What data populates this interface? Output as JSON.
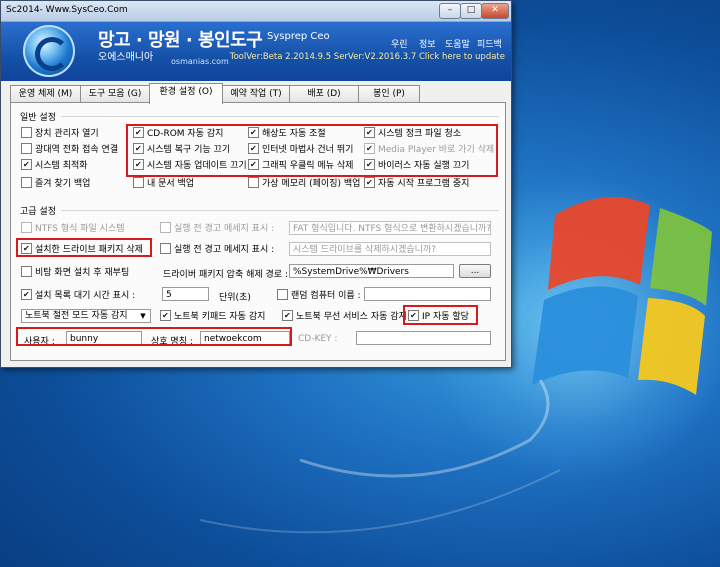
{
  "window": {
    "title": "Sc2014- Www.SysCeo.Com",
    "controls": {
      "minimize": "–",
      "maximize": "□",
      "close": "✕"
    }
  },
  "banner": {
    "title": "망고 · 망원 · 봉인도구",
    "sysprep": "Sysprep Ceo",
    "subtitle": "오에스매니아",
    "site": "osmanias.com",
    "menu": [
      "우린",
      "정보",
      "도움말",
      "피드백"
    ],
    "version": "ToolVer:Beta 2.2014.9.5 SerVer:V2.2016.3.7 Click here to update"
  },
  "tabs": [
    {
      "label": "운영 체제 (M)"
    },
    {
      "label": "도구 모음 (G)"
    },
    {
      "label": "환경 설정 (O)",
      "active": true
    },
    {
      "label": "예약 작업 (T)"
    },
    {
      "label": "배포 (D)"
    },
    {
      "label": "봉인 (P)"
    }
  ],
  "general": {
    "title": "일반 설정",
    "col1": [
      {
        "label": "장치 관리자 열기",
        "checked": false
      },
      {
        "label": "광대역 전화 접속 연결",
        "checked": false
      },
      {
        "label": "시스템 최적화",
        "checked": true
      },
      {
        "label": "즐겨 찾기 백업",
        "checked": false
      }
    ],
    "col2": [
      {
        "label": "CD-ROM 자동 감지",
        "checked": true
      },
      {
        "label": "시스템 복구 기능 끄기",
        "checked": true
      },
      {
        "label": "시스템 자동 업데이트 끄기",
        "checked": true
      },
      {
        "label": "내 문서 백업",
        "checked": false
      }
    ],
    "col3": [
      {
        "label": "해상도 자동 조절",
        "checked": true
      },
      {
        "label": "인터넷 마법사 건너 뛰기",
        "checked": true
      },
      {
        "label": "그래픽 우클릭 메뉴 삭제",
        "checked": true
      },
      {
        "label": "가상 메모리 (페이징) 백업",
        "checked": false
      }
    ],
    "col4": [
      {
        "label": "시스템 정크 파일 청소",
        "checked": true
      },
      {
        "label": "Media Player 바로 가기 삭제",
        "checked": true,
        "disabled": true
      },
      {
        "label": "바이러스 자동 실행 끄기",
        "checked": true
      },
      {
        "label": "자동 시작 프로그램 중지",
        "checked": true
      }
    ]
  },
  "advanced": {
    "title": "고급 설정",
    "ntfs": {
      "label": "NTFS 형식 파일 시스템",
      "checked": false
    },
    "warn1": {
      "label": "실행 전 경고 메세지 표시 :",
      "checked": false,
      "value": "FAT 형식입니다. NTFS 형식으로 변환하시겠습니까?"
    },
    "driver_delete": {
      "label": "설치한 드라이브 패키지 삭제",
      "checked": true
    },
    "warn2": {
      "label": "실행 전 경고 메세지 표시 :",
      "checked": false,
      "value": "시스템 드라이브를 삭제하시겠습니까?"
    },
    "reboot": {
      "label": "비탕 화면 설치 후 재부팅",
      "checked": false
    },
    "driver_path": {
      "label": "드라이버 패키지 압축 해제 경로 :",
      "value": "%SystemDrive%₩Drivers",
      "browse": "..."
    },
    "wait": {
      "label": "설치 목록 대기 시간 표시 :",
      "checked": true,
      "value": "5",
      "unit": "단위(초)"
    },
    "random_name": {
      "label": "랜덤 컴퓨터 이름 :",
      "checked": false,
      "value": ""
    },
    "power_mode": {
      "value": "노트북 절전 모드 자동 감지"
    },
    "keypad": {
      "label": "노트북 키패드 자동 감지",
      "checked": true
    },
    "wireless": {
      "label": "노트북 무선 서비스 자동 감지",
      "checked": true
    },
    "ip_auto": {
      "label": "IP 자동 할당",
      "checked": true
    },
    "user": {
      "label": "사용자 :",
      "value": "bunny"
    },
    "org": {
      "label": "상호 명칭 :",
      "value": "netwoekcom"
    },
    "cdkey": {
      "label": "CD-KEY :",
      "value": ""
    }
  },
  "accent": {
    "banner_blue": "#1551a8",
    "highlight_red": "#d81a1a"
  }
}
